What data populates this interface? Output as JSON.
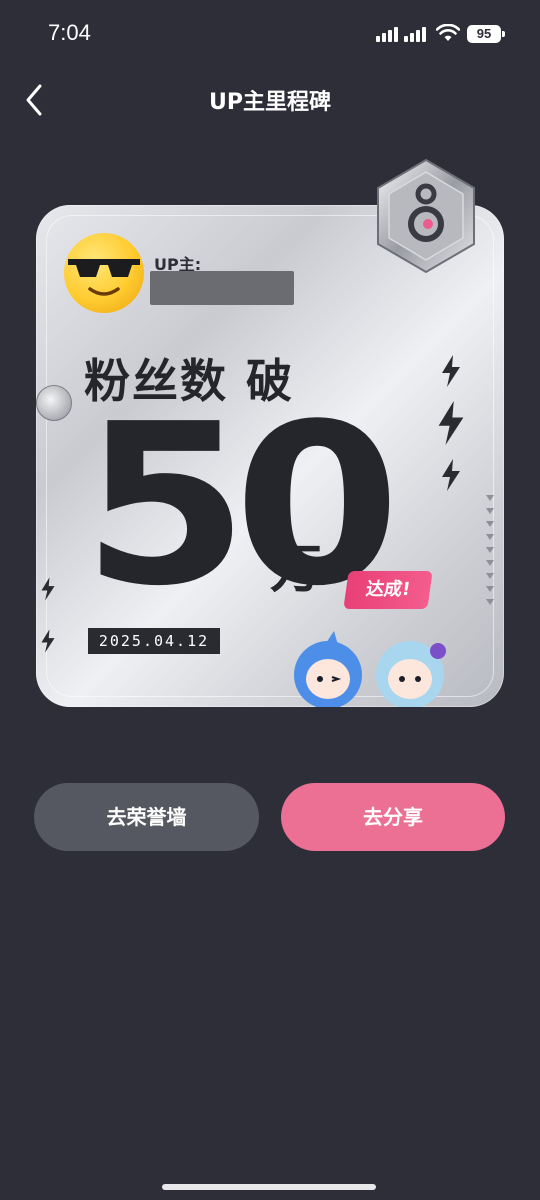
{
  "status_bar": {
    "time": "7:04",
    "battery": "95"
  },
  "nav": {
    "title": "UP主里程碑"
  },
  "card": {
    "up_label": "UP主:",
    "headline": "粉丝数 破",
    "number": "50",
    "unit": "万",
    "achieved_tag": "达成!",
    "date": "2025.04.12"
  },
  "buttons": {
    "honor_wall": "去荣誉墙",
    "share": "去分享"
  },
  "colors": {
    "background": "#2d2e38",
    "accent_pink": "#ec6f94",
    "secondary_button": "#565861"
  },
  "icons": [
    "back-chevron-icon",
    "signal-icon",
    "wifi-icon",
    "battery-icon",
    "lightning-icon",
    "sunglasses-emoji-avatar",
    "medal-hexagon-icon"
  ]
}
